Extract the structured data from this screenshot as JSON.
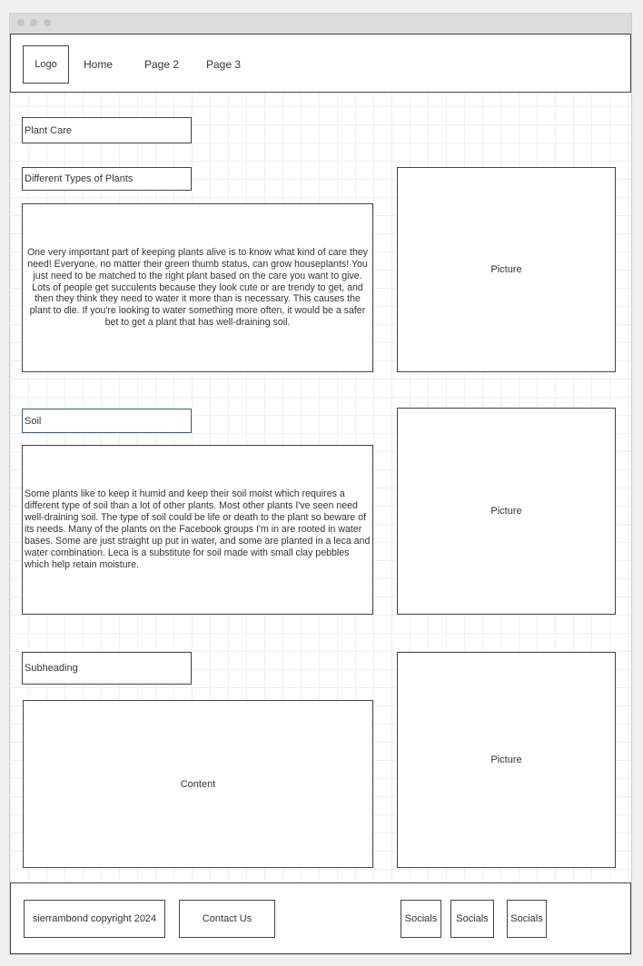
{
  "header": {
    "logo": "Logo",
    "nav": [
      {
        "label": "Home"
      },
      {
        "label": "Page 2"
      },
      {
        "label": "Page 3"
      }
    ]
  },
  "main": {
    "page_title": "Plant Care",
    "sections": [
      {
        "heading": "Different Types of Plants",
        "content": "One very important part of keeping plants alive is to know what kind of care they need! Everyone, no matter their green thumb status, can grow houseplants! You just need to be matched to the right plant based on the care you want to give. Lots of people get succulents because they look cute or are trendy to get, and then they think they need to water it more than is necessary. This causes the plant to die. If you're looking to water something more often, it would be a safer bet to get a plant that has well-draining soil.",
        "picture": "Picture"
      },
      {
        "heading": "Soil",
        "content": "Some plants like to keep it humid and keep their soil moist which requires a different type of soil than a lot of other plants. Most other plants I've seen need well-draining soil. The type of soil could be life or death to the plant so beware of its needs. Many of the plants on the Facebook groups I'm in are rooted in water bases. Some are just straight up put in water, and some are planted in a leca and water combination. Leca is a substitute for soil made with small clay pebbles which help retain moisture.",
        "picture": "Picture"
      },
      {
        "heading": "Subheading",
        "content": "Content",
        "picture": "Picture"
      }
    ]
  },
  "footer": {
    "copyright": "sierrambond copyright 2024",
    "contact": "Contact Us",
    "socials": [
      "Socials",
      "Socials",
      "Socials"
    ]
  }
}
